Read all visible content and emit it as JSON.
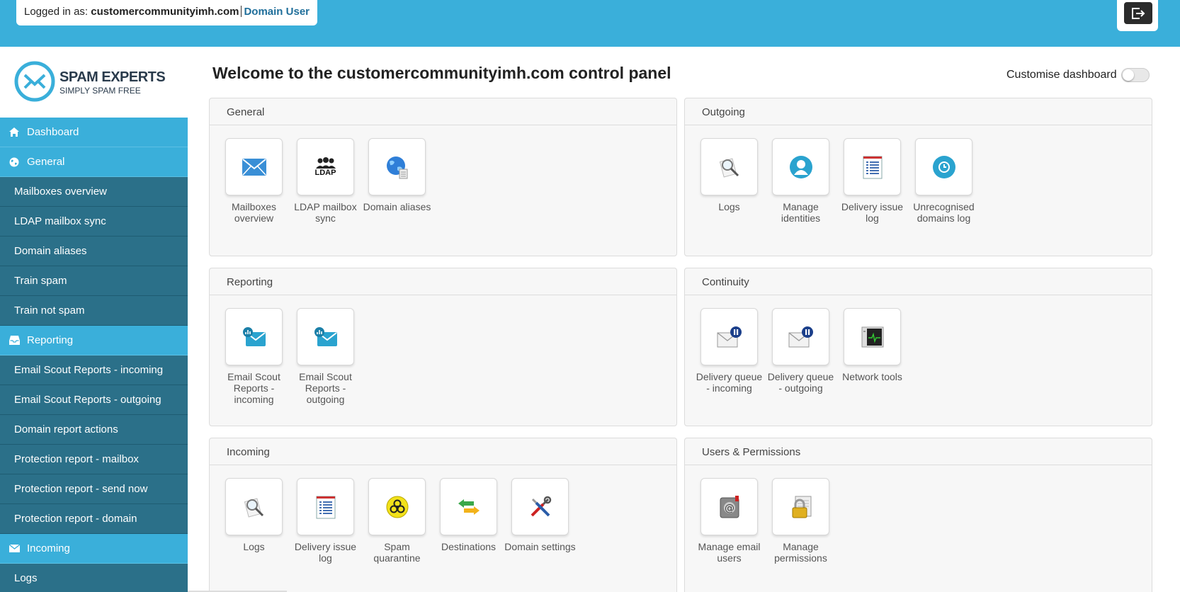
{
  "header": {
    "logged_in_label": "Logged in as:",
    "domain": "customercommunityimh.com",
    "role": "Domain User"
  },
  "logo": {
    "name": "SPAM EXPERTS",
    "tagline": "SIMPLY SPAM FREE"
  },
  "sidebar": {
    "items": [
      {
        "label": "Dashboard",
        "type": "section",
        "icon": "home-icon"
      },
      {
        "label": "General",
        "type": "section",
        "icon": "globe-icon"
      },
      {
        "label": "Mailboxes overview",
        "type": "sub"
      },
      {
        "label": "LDAP mailbox sync",
        "type": "sub"
      },
      {
        "label": "Domain aliases",
        "type": "sub"
      },
      {
        "label": "Train spam",
        "type": "sub"
      },
      {
        "label": "Train not spam",
        "type": "sub"
      },
      {
        "label": "Reporting",
        "type": "section",
        "icon": "inbox-icon"
      },
      {
        "label": "Email Scout Reports - incoming",
        "type": "sub"
      },
      {
        "label": "Email Scout Reports - outgoing",
        "type": "sub"
      },
      {
        "label": "Domain report actions",
        "type": "sub"
      },
      {
        "label": "Protection report - mailbox",
        "type": "sub"
      },
      {
        "label": "Protection report - send now",
        "type": "sub"
      },
      {
        "label": "Protection report - domain",
        "type": "sub"
      },
      {
        "label": "Incoming",
        "type": "section",
        "icon": "envelope-icon"
      },
      {
        "label": "Logs",
        "type": "sub"
      }
    ]
  },
  "main": {
    "title": "Welcome to the customercommunityimh.com control panel",
    "customise_label": "Customise dashboard",
    "panels": [
      {
        "title": "General",
        "tiles": [
          {
            "label": "Mailboxes overview",
            "icon": "envelope-icon"
          },
          {
            "label": "LDAP mailbox sync",
            "icon": "ldap-users-icon",
            "icon_text": "LDAP"
          },
          {
            "label": "Domain aliases",
            "icon": "globe-document-icon"
          }
        ]
      },
      {
        "title": "Outgoing",
        "tiles": [
          {
            "label": "Logs",
            "icon": "magnifier-icon"
          },
          {
            "label": "Manage identities",
            "icon": "user-icon"
          },
          {
            "label": "Delivery issue log",
            "icon": "document-list-icon"
          },
          {
            "label": "Unrecognised domains log",
            "icon": "clock-icon"
          }
        ]
      },
      {
        "title": "Reporting",
        "tiles": [
          {
            "label": "Email Scout Reports - incoming",
            "icon": "envelope-chart-icon"
          },
          {
            "label": "Email Scout Reports - outgoing",
            "icon": "envelope-chart-icon"
          }
        ]
      },
      {
        "title": "Continuity",
        "tiles": [
          {
            "label": "Delivery queue - incoming",
            "icon": "envelope-pause-icon"
          },
          {
            "label": "Delivery queue - outgoing",
            "icon": "envelope-pause-icon"
          },
          {
            "label": "Network tools",
            "icon": "monitor-icon"
          }
        ]
      },
      {
        "title": "Incoming",
        "tiles": [
          {
            "label": "Logs",
            "icon": "magnifier-icon"
          },
          {
            "label": "Delivery issue log",
            "icon": "document-list-icon"
          },
          {
            "label": "Spam quarantine",
            "icon": "biohazard-icon"
          },
          {
            "label": "Destinations",
            "icon": "arrows-icon"
          },
          {
            "label": "Domain settings",
            "icon": "tools-icon"
          }
        ]
      },
      {
        "title": "Users & Permissions",
        "tiles": [
          {
            "label": "Manage email users",
            "icon": "at-safe-icon"
          },
          {
            "label": "Manage permissions",
            "icon": "lock-document-icon"
          }
        ]
      }
    ]
  },
  "colors": {
    "topbar": "#3aafda",
    "sidebar_section": "#3aafda",
    "sidebar_sub": "#2b7089"
  }
}
